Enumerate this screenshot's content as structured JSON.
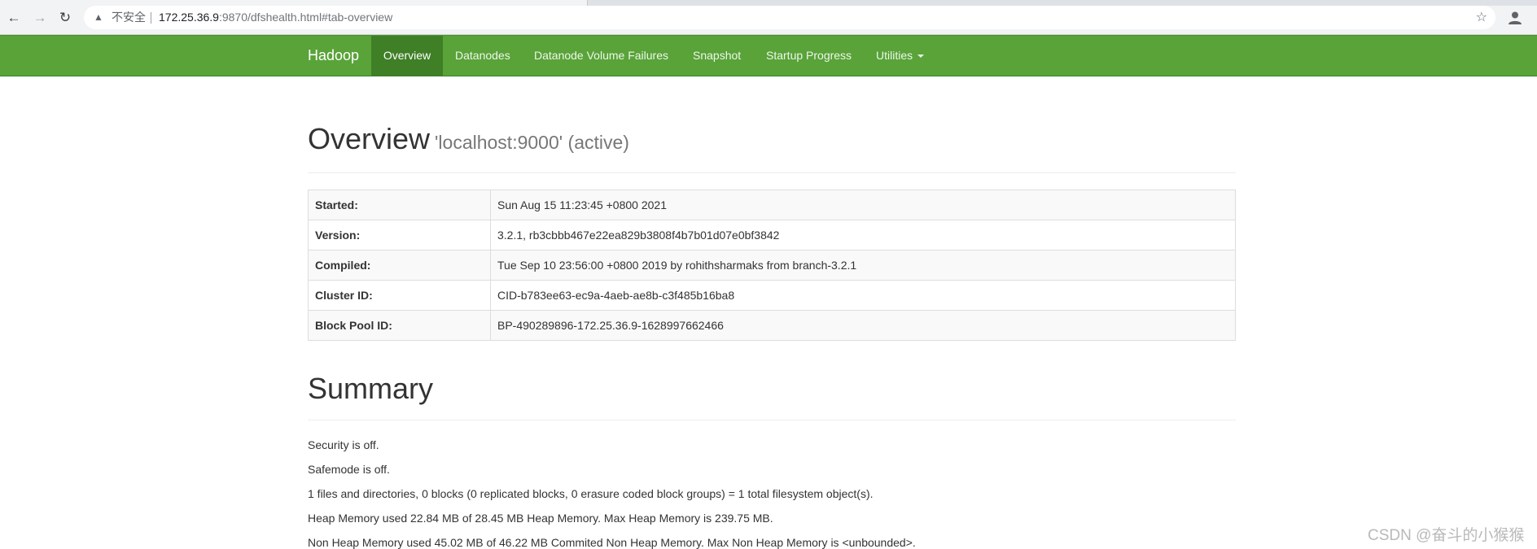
{
  "browser": {
    "insecure_label": "不安全",
    "url_host": "172.25.36.9",
    "url_rest": ":9870/dfshealth.html#tab-overview"
  },
  "navbar": {
    "brand": "Hadoop",
    "items": [
      {
        "label": "Overview",
        "active": true
      },
      {
        "label": "Datanodes",
        "active": false
      },
      {
        "label": "Datanode Volume Failures",
        "active": false
      },
      {
        "label": "Snapshot",
        "active": false
      },
      {
        "label": "Startup Progress",
        "active": false
      },
      {
        "label": "Utilities",
        "active": false
      }
    ],
    "colors": {
      "bar": "#59a339",
      "active": "#3f7f26"
    }
  },
  "overview": {
    "title": "Overview",
    "subtitle": "'localhost:9000' (active)",
    "rows": [
      {
        "key": "Started:",
        "value": "Sun Aug 15 11:23:45 +0800 2021"
      },
      {
        "key": "Version:",
        "value": "3.2.1, rb3cbbb467e22ea829b3808f4b7b01d07e0bf3842"
      },
      {
        "key": "Compiled:",
        "value": "Tue Sep 10 23:56:00 +0800 2019 by rohithsharmaks from branch-3.2.1"
      },
      {
        "key": "Cluster ID:",
        "value": "CID-b783ee63-ec9a-4aeb-ae8b-c3f485b16ba8"
      },
      {
        "key": "Block Pool ID:",
        "value": "BP-490289896-172.25.36.9-1628997662466"
      }
    ]
  },
  "summary": {
    "title": "Summary",
    "lines": [
      "Security is off.",
      "Safemode is off.",
      "1 files and directories, 0 blocks (0 replicated blocks, 0 erasure coded block groups) = 1 total filesystem object(s).",
      "Heap Memory used 22.84 MB of 28.45 MB Heap Memory. Max Heap Memory is 239.75 MB.",
      "Non Heap Memory used 45.02 MB of 46.22 MB Commited Non Heap Memory. Max Non Heap Memory is <unbounded>."
    ]
  },
  "watermark": "CSDN @奋斗的小猴猴"
}
